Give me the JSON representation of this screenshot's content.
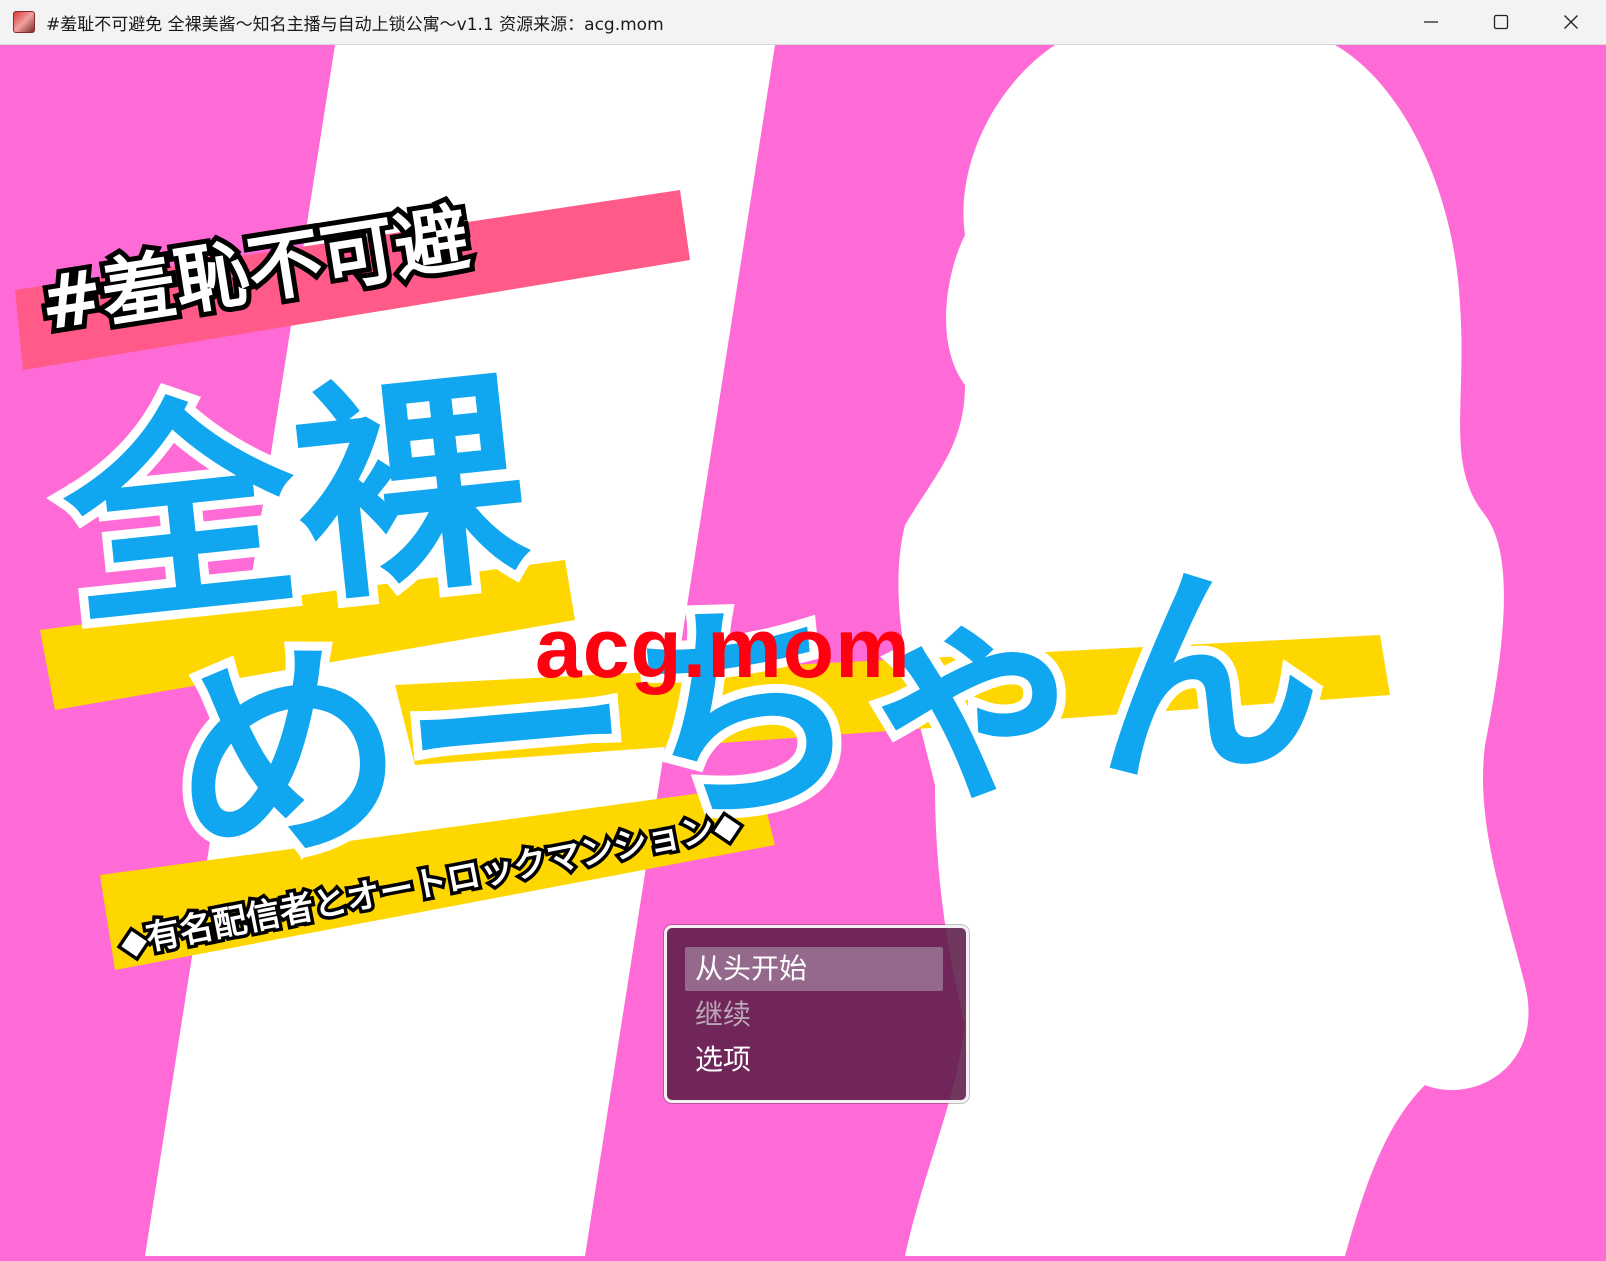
{
  "window": {
    "title": "#羞耻不可避免 全裸美酱～知名主播与自动上锁公寓～v1.1 资源来源：acg.mom"
  },
  "logo": {
    "hashtag_line": "#羞恥不可避",
    "main_kanji": "全裸",
    "main_kana": "めーちゃん",
    "subtitle": "◆有名配信者とオートロックマンション◆"
  },
  "watermark": "acg.mom",
  "menu": {
    "items": [
      {
        "label": "从头开始",
        "state": "selected"
      },
      {
        "label": "继续",
        "state": "disabled"
      },
      {
        "label": "选项",
        "state": "enabled"
      }
    ]
  },
  "colors": {
    "background_pink": "#ff6bd6",
    "stripe_white": "#ffffff",
    "logo_blue": "#10a6f0",
    "logo_light_blue": "#7dd4ff",
    "banner_red": "#ff5a88",
    "banner_yellow": "#ffd700",
    "watermark_red": "#ff0010",
    "menu_bg": "#5c1c48"
  }
}
